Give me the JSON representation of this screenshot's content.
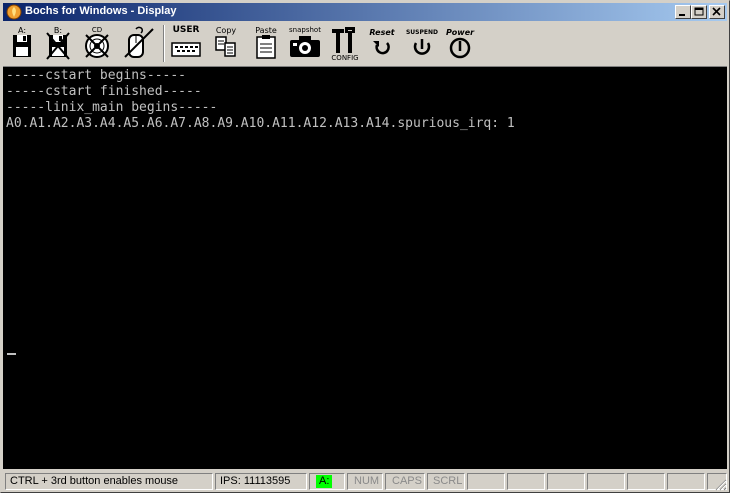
{
  "window": {
    "title": "Bochs for Windows - Display",
    "controls": {
      "minimize": "minimize-icon",
      "maximize": "maximize-icon",
      "close": "close-icon"
    }
  },
  "toolbar": {
    "floppy_a_label": "A:",
    "floppy_b_label": "B:",
    "cdrom_label": "CD",
    "user_label": "USER",
    "copy_label": "Copy",
    "paste_label": "Paste",
    "snapshot_label": "snapshot",
    "config_label": "CONFIG",
    "reset_label": "Reset",
    "suspend_label": "SUSPEND",
    "power_label": "Power"
  },
  "console": {
    "lines": [
      "-----cstart begins-----",
      "-----cstart finished-----",
      "-----linix_main begins-----",
      "A0.A1.A2.A3.A4.A5.A6.A7.A8.A9.A10.A11.A12.A13.A14.spurious_irq: 1"
    ],
    "fg_color": "#c0c0c0",
    "bg_color": "#000000"
  },
  "statusbar": {
    "mouse_hint": "CTRL + 3rd button enables mouse",
    "ips": "IPS:  11113595",
    "drive_a": "A:",
    "num": "NUM",
    "caps": "CAPS",
    "scrl": "SCRL",
    "led_color": "#00ff00"
  },
  "colors": {
    "face": "#d4d0c8",
    "title_gradient_start": "#0a246a",
    "title_gradient_end": "#a6caf0"
  }
}
